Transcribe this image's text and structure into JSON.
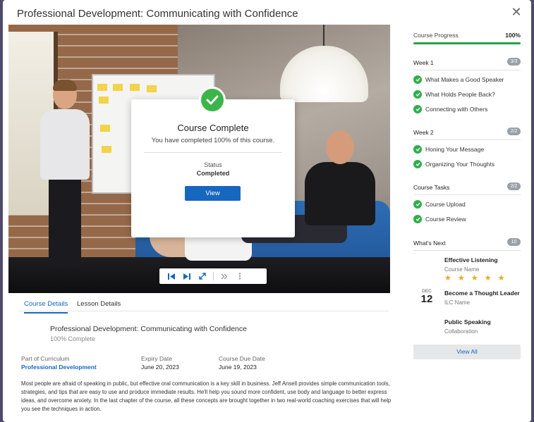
{
  "modal": {
    "title": "Professional Development: Communicating with Confidence",
    "close_label": "✕"
  },
  "completion_card": {
    "title": "Course Complete",
    "subtitle": "You have completed 100% of this course.",
    "status_label": "Status",
    "status_value": "Completed",
    "view_button": "View"
  },
  "player": {
    "controls": [
      "skip-back-icon",
      "play-next-icon",
      "fullscreen-icon",
      "forward-icon",
      "more-icon"
    ]
  },
  "tabs": [
    {
      "label": "Course Details",
      "active": true
    },
    {
      "label": "Lesson Details",
      "active": false
    }
  ],
  "details": {
    "title": "Professional Development: Communicating with Confidence",
    "completion": "100% Complete",
    "curriculum_label": "Part of Curriculum",
    "curriculum_value": "Professional Development",
    "expiry_label": "Expiry Date",
    "expiry_value": "June 20, 2023",
    "due_label": "Course Due Date",
    "due_value": "June 19, 2023",
    "description": "Most people are afraid of speaking in public, but effective oral communication is a key skill in business. Jeff Ansell provides simple communication tools, strategies, and tips that are easy to use and produce immediate results. He'll help you sound more confident, use body and language to better express ideas, and overcome anxiety. In the last chapter of the course, all these concepts are brought together in two real-world coaching exercises that will help you see the techniques in action."
  },
  "sidebar": {
    "progress_label": "Course Progress",
    "progress_value": "100%",
    "progress_fraction": 1.0,
    "sections": [
      {
        "title": "Week 1",
        "badge": "3/3",
        "items": [
          "What Makes a Good Speaker",
          "What Holds People Back?",
          "Connecting with Others"
        ]
      },
      {
        "title": "Week 2",
        "badge": "2/2",
        "items": [
          "Honing Your Message",
          "Organizing Your Thoughts"
        ]
      },
      {
        "title": "Course Tasks",
        "badge": "2/2",
        "items": [
          "Course Upload",
          "Course Review"
        ]
      }
    ],
    "whats_next": {
      "title": "What's Next",
      "badge": "10",
      "items": [
        {
          "title": "Effective Listening",
          "subtitle": "Course Name",
          "stars": "★ ★ ★ ★ ★"
        },
        {
          "title": "Become a Thought Leader",
          "subtitle": "ILC Name",
          "month": "DEC",
          "day": "12"
        },
        {
          "title": "Public Speaking",
          "subtitle": "Collaboration"
        }
      ],
      "view_all": "View All"
    }
  },
  "colors": {
    "accent": "#1767c0",
    "success": "#2fae4c",
    "star": "#f0a521",
    "backdrop": "#5b5678"
  }
}
